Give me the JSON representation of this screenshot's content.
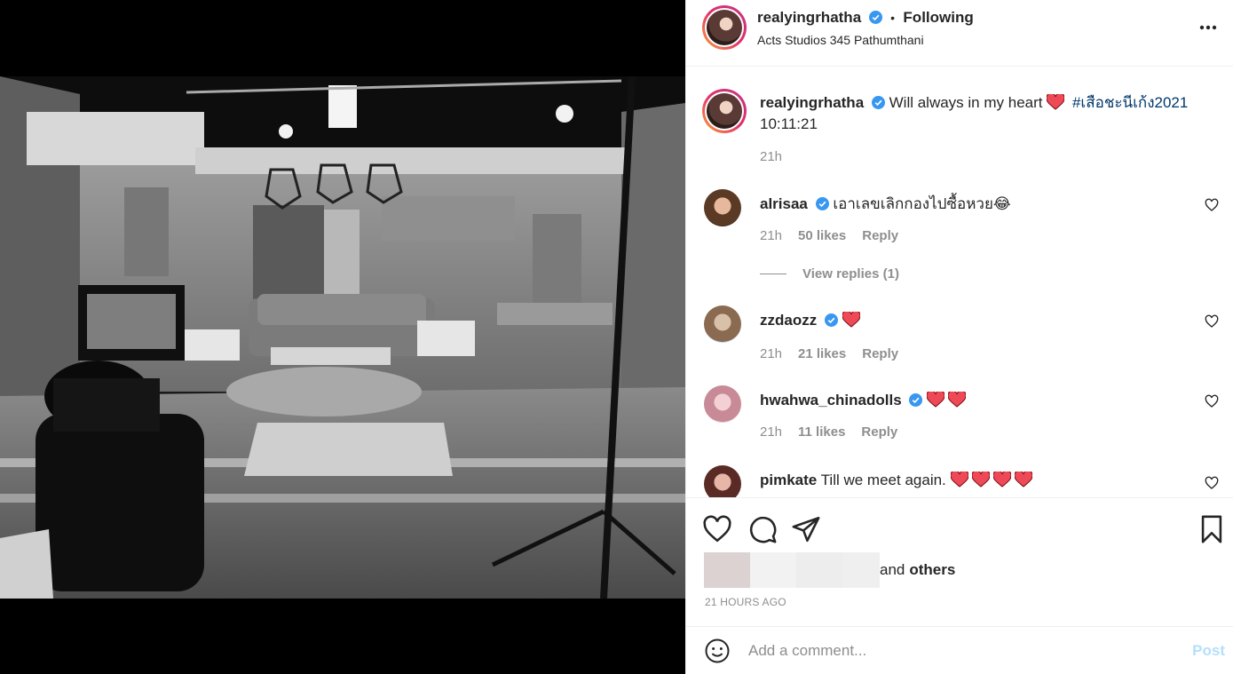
{
  "post": {
    "author": "realyingrhatha",
    "follow_status": "Following",
    "separator": "•",
    "location": "Acts Studios 345 Pathumthani",
    "more_icon": "more-horizontal-icon"
  },
  "caption": {
    "author": "realyingrhatha",
    "text": "Will always in my heart",
    "hashtag": "#เสือชะนีเก้ง2021",
    "second_line": "10:11:21",
    "time": "21h"
  },
  "comments": [
    {
      "user": "alrisaa",
      "verified": true,
      "text": "เอาเลขเลิกกองไปซื้อหวย😂",
      "hearts": 0,
      "time": "21h",
      "likes": "50 likes",
      "reply": "Reply",
      "view_replies": "View replies (1)"
    },
    {
      "user": "zzdaozz",
      "verified": true,
      "text": "",
      "hearts": 1,
      "time": "21h",
      "likes": "21 likes",
      "reply": "Reply"
    },
    {
      "user": "hwahwa_chinadolls",
      "verified": true,
      "text": "",
      "hearts": 2,
      "time": "21h",
      "likes": "11 likes",
      "reply": "Reply"
    },
    {
      "user": "pimkate",
      "verified": false,
      "text": "Till we meet again.",
      "hearts": 4
    }
  ],
  "actions": {
    "like_icon": "heart-outline-icon",
    "comment_icon": "comment-bubble-icon",
    "share_icon": "paper-plane-icon",
    "save_icon": "bookmark-icon"
  },
  "likes": {
    "suffix": "and",
    "others": "others"
  },
  "timestamp": "21 HOURS AGO",
  "comment_input": {
    "placeholder": "Add a comment...",
    "post_label": "Post",
    "emoji_icon": "smiley-icon"
  },
  "colors": {
    "verified": "#3897f0",
    "heart": "#ed4956",
    "link": "#00376b",
    "muted": "#8e8e8e",
    "post_disabled": "#b2dffc"
  }
}
